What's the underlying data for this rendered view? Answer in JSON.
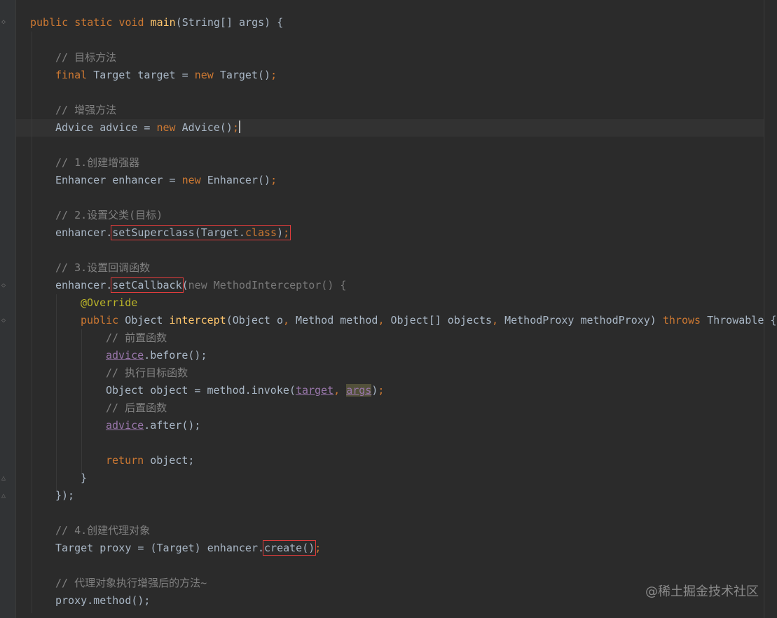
{
  "editor": {
    "line1": {
      "kw1": "public",
      "kw2": "static",
      "kw3": "void",
      "method": "main",
      "params": "(String[] args) {"
    },
    "line3": {
      "comment": "// 目标方法"
    },
    "line4": {
      "kw": "final",
      "type": "Target",
      "name": "target",
      "eq": " = ",
      "new": "new",
      "ctor": "Target()",
      "semi": ";"
    },
    "line6": {
      "comment": "// 增强方法"
    },
    "line7": {
      "type": "Advice",
      "name": "advice",
      "eq": " = ",
      "new": "new",
      "ctor": "Advice()",
      "semi": ";"
    },
    "line9": {
      "comment": "// 1.创建增强器"
    },
    "line10": {
      "type": "Enhancer",
      "name": "enhancer",
      "eq": " = ",
      "new": "new",
      "ctor": "Enhancer()",
      "semi": ";"
    },
    "line12": {
      "comment": "// 2.设置父类(目标)"
    },
    "line13": {
      "obj": "enhancer.",
      "call": "setSuperclass(Target.",
      "cls": "class",
      "close": ")",
      "semi": ";"
    },
    "line15": {
      "comment": "// 3.设置回调函数"
    },
    "line16": {
      "obj": "enhancer.",
      "call": "setCallback",
      "open": "(",
      "new": "new",
      "anon": "MethodInterceptor() {"
    },
    "line17": {
      "annotation": "@Override"
    },
    "line18": {
      "kw": "public",
      "ret": "Object",
      "method": "intercept",
      "p1": "(Object o",
      "p2": " Method method",
      "p3": " Object[] objects",
      "p4": " MethodProxy methodProxy)",
      "throws": "throws",
      "ex": "Throwable {"
    },
    "line19": {
      "comment": "// 前置函数"
    },
    "line20": {
      "field": "advice",
      "rest": ".before();"
    },
    "line21": {
      "comment": "// 执行目标函数"
    },
    "line22": {
      "decl": "Object object = method.invoke(",
      "arg1": "target",
      "arg2": "args",
      "rest": ")",
      "semi": ";"
    },
    "line23": {
      "comment": "// 后置函数"
    },
    "line24": {
      "field": "advice",
      "rest": ".after();"
    },
    "line26": {
      "kw": "return",
      "rest": "object;"
    },
    "line27": {
      "text": "}"
    },
    "line28": {
      "text": "});"
    },
    "line30": {
      "comment": "// 4.创建代理对象"
    },
    "line31": {
      "decl": "Target proxy = (Target) enhancer.",
      "call": "create()",
      "semi": ";"
    },
    "line33": {
      "comment": "// 代理对象执行增强后的方法~"
    },
    "line34": {
      "text": "proxy.method();"
    }
  },
  "watermark": "@稀土掘金技术社区",
  "colors": {
    "background": "#2b2b2b",
    "keyword": "#cc7832",
    "method": "#ffc66d",
    "comment": "#808080",
    "field": "#9876aa",
    "annotation": "#bbb529",
    "text": "#a9b7c6",
    "highlight_box": "#e03c3c"
  }
}
